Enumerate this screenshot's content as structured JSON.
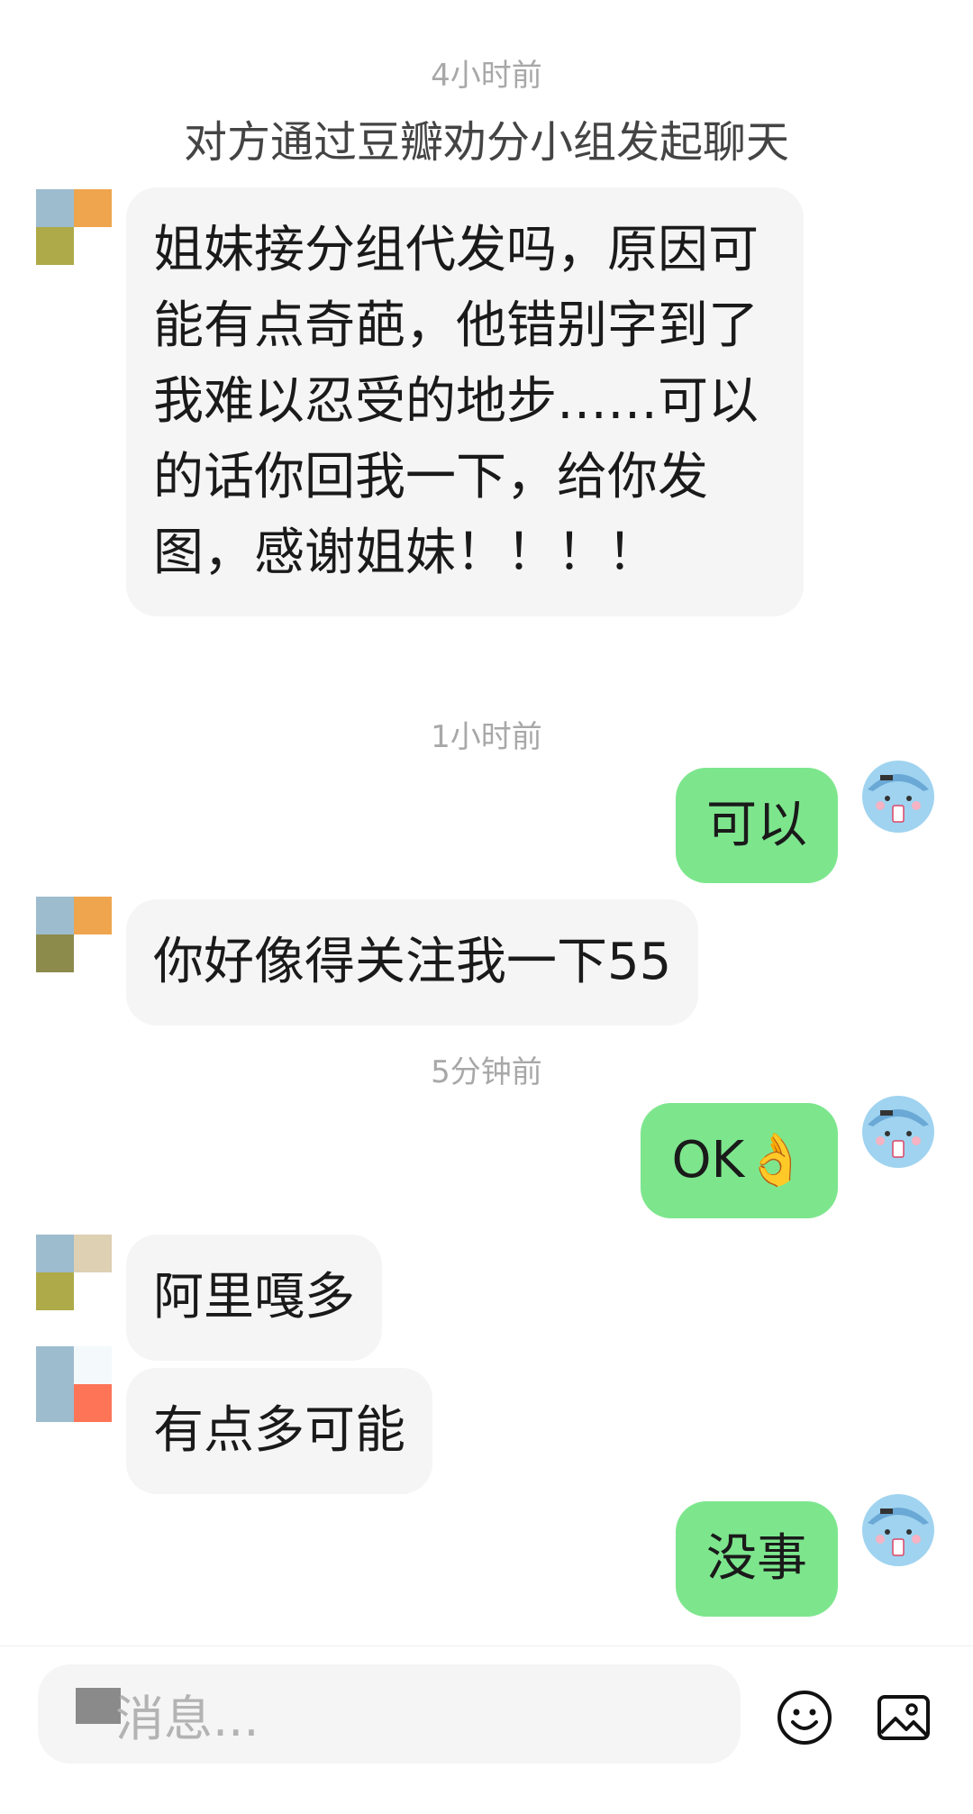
{
  "messages": [
    {
      "type": "timestamp",
      "text": "4小时前"
    },
    {
      "type": "system",
      "text": "对方通过豆瓣劝分小组发起聊天"
    },
    {
      "type": "incoming",
      "text": "姐妹接分组代发吗，原因可能有点奇葩，他错别字到了我难以忍受的地步……可以的话你回我一下，给你发图，感谢姐妹！！！！"
    },
    {
      "type": "timestamp",
      "text": "1小时前"
    },
    {
      "type": "outgoing",
      "text": "可以"
    },
    {
      "type": "incoming",
      "text": "你好像得关注我一下55"
    },
    {
      "type": "timestamp",
      "text": "5分钟前"
    },
    {
      "type": "outgoing",
      "text": "OK👌"
    },
    {
      "type": "incoming",
      "text": "阿里嘎多"
    },
    {
      "type": "incoming",
      "text": "有点多可能"
    },
    {
      "type": "outgoing",
      "text": "没事"
    }
  ],
  "input": {
    "placeholder": "消息..."
  },
  "icons": {
    "emoji": "smiley-icon",
    "image": "image-picker-icon"
  },
  "colors": {
    "outgoing_bubble": "#7de68d",
    "incoming_bubble": "#f5f5f5",
    "timestamp_text": "#a8a8a8"
  }
}
